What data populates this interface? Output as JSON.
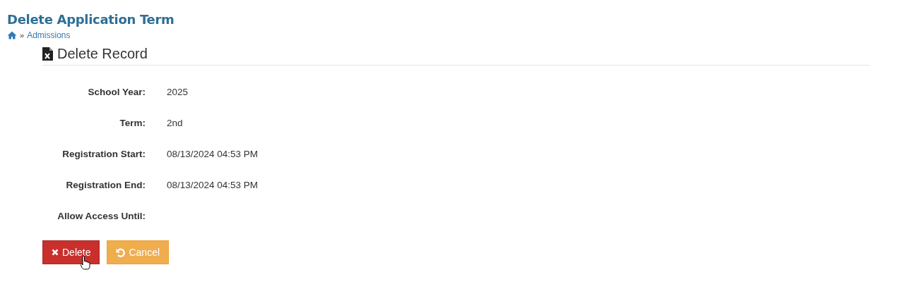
{
  "page_title": "Delete Application Term",
  "breadcrumb": {
    "separator": "»",
    "items": [
      {
        "label": "Admissions"
      }
    ]
  },
  "panel": {
    "title": "Delete Record"
  },
  "fields": [
    {
      "label": "School Year:",
      "value": "2025"
    },
    {
      "label": "Term:",
      "value": "2nd"
    },
    {
      "label": "Registration Start:",
      "value": "08/13/2024 04:53 PM"
    },
    {
      "label": "Registration End:",
      "value": "08/13/2024 04:53 PM"
    },
    {
      "label": "Allow Access Until:"
    }
  ],
  "buttons": [
    {
      "kind": "delete",
      "label": "Delete"
    },
    {
      "kind": "cancel",
      "label": "Cancel"
    }
  ]
}
